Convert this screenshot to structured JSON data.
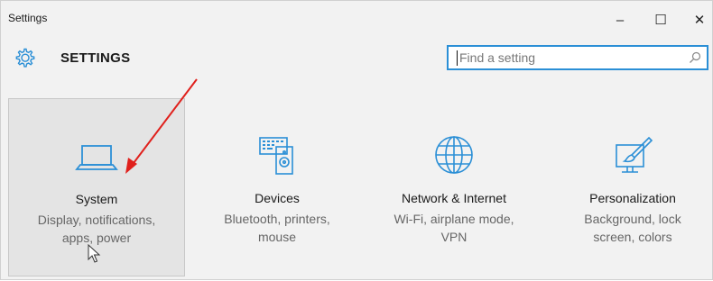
{
  "window": {
    "title": "Settings",
    "controls": {
      "minimize": "–",
      "maximize": "☐",
      "close": "✕"
    }
  },
  "header": {
    "title": "SETTINGS",
    "icon": "gear-icon",
    "accent": "#2b8fd6"
  },
  "search": {
    "placeholder": "Find a setting",
    "value": ""
  },
  "tiles": [
    {
      "name": "System",
      "desc1": "Display, notifications,",
      "desc2": "apps, power",
      "icon": "laptop-icon",
      "selected": true
    },
    {
      "name": "Devices",
      "desc1": "Bluetooth, printers,",
      "desc2": "mouse",
      "icon": "devices-icon",
      "selected": false
    },
    {
      "name": "Network & Internet",
      "desc1": "Wi-Fi, airplane mode,",
      "desc2": "VPN",
      "icon": "globe-icon",
      "selected": false
    },
    {
      "name": "Personalization",
      "desc1": "Background, lock",
      "desc2": "screen, colors",
      "icon": "paint-icon",
      "selected": false
    }
  ],
  "annotation": {
    "arrow_color": "#e0201c"
  }
}
